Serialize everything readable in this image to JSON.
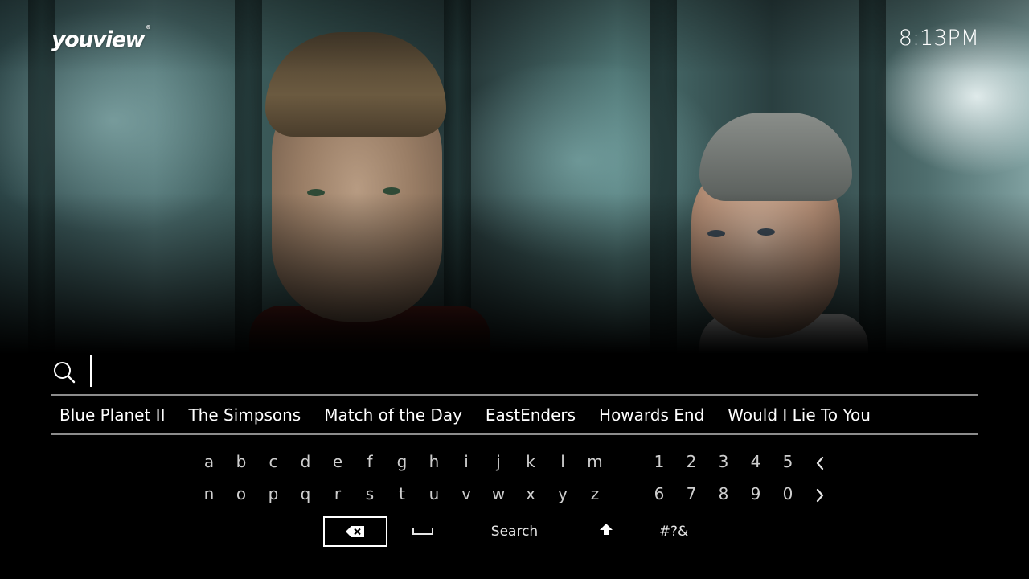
{
  "header": {
    "logo_text": "youview",
    "logo_mark": "®",
    "clock": "8:13PM"
  },
  "search": {
    "value": "",
    "icon": "search-icon"
  },
  "suggestions": [
    "Blue Planet II",
    "The Simpsons",
    "Match of the Day",
    "EastEnders",
    "Howards End",
    "Would I Lie To You"
  ],
  "keyboard": {
    "row1_letters": [
      "a",
      "b",
      "c",
      "d",
      "e",
      "f",
      "g",
      "h",
      "i",
      "j",
      "k",
      "l",
      "m"
    ],
    "row2_letters": [
      "n",
      "o",
      "p",
      "q",
      "r",
      "s",
      "t",
      "u",
      "v",
      "w",
      "x",
      "y",
      "z"
    ],
    "row1_digits": [
      "1",
      "2",
      "3",
      "4",
      "5"
    ],
    "row2_digits": [
      "6",
      "7",
      "8",
      "9",
      "0"
    ],
    "row1_arrow": "chevron-left-icon",
    "row2_arrow": "chevron-right-icon",
    "actions": {
      "backspace_icon": "backspace-icon",
      "space_icon": "space-icon",
      "search_label": "Search",
      "shift_icon": "shift-icon",
      "symbols_label": "#?&"
    }
  },
  "colors": {
    "background": "#000000",
    "text": "#ffffff",
    "key_text": "#cfcfcf",
    "rule": "#8c8c8c"
  }
}
